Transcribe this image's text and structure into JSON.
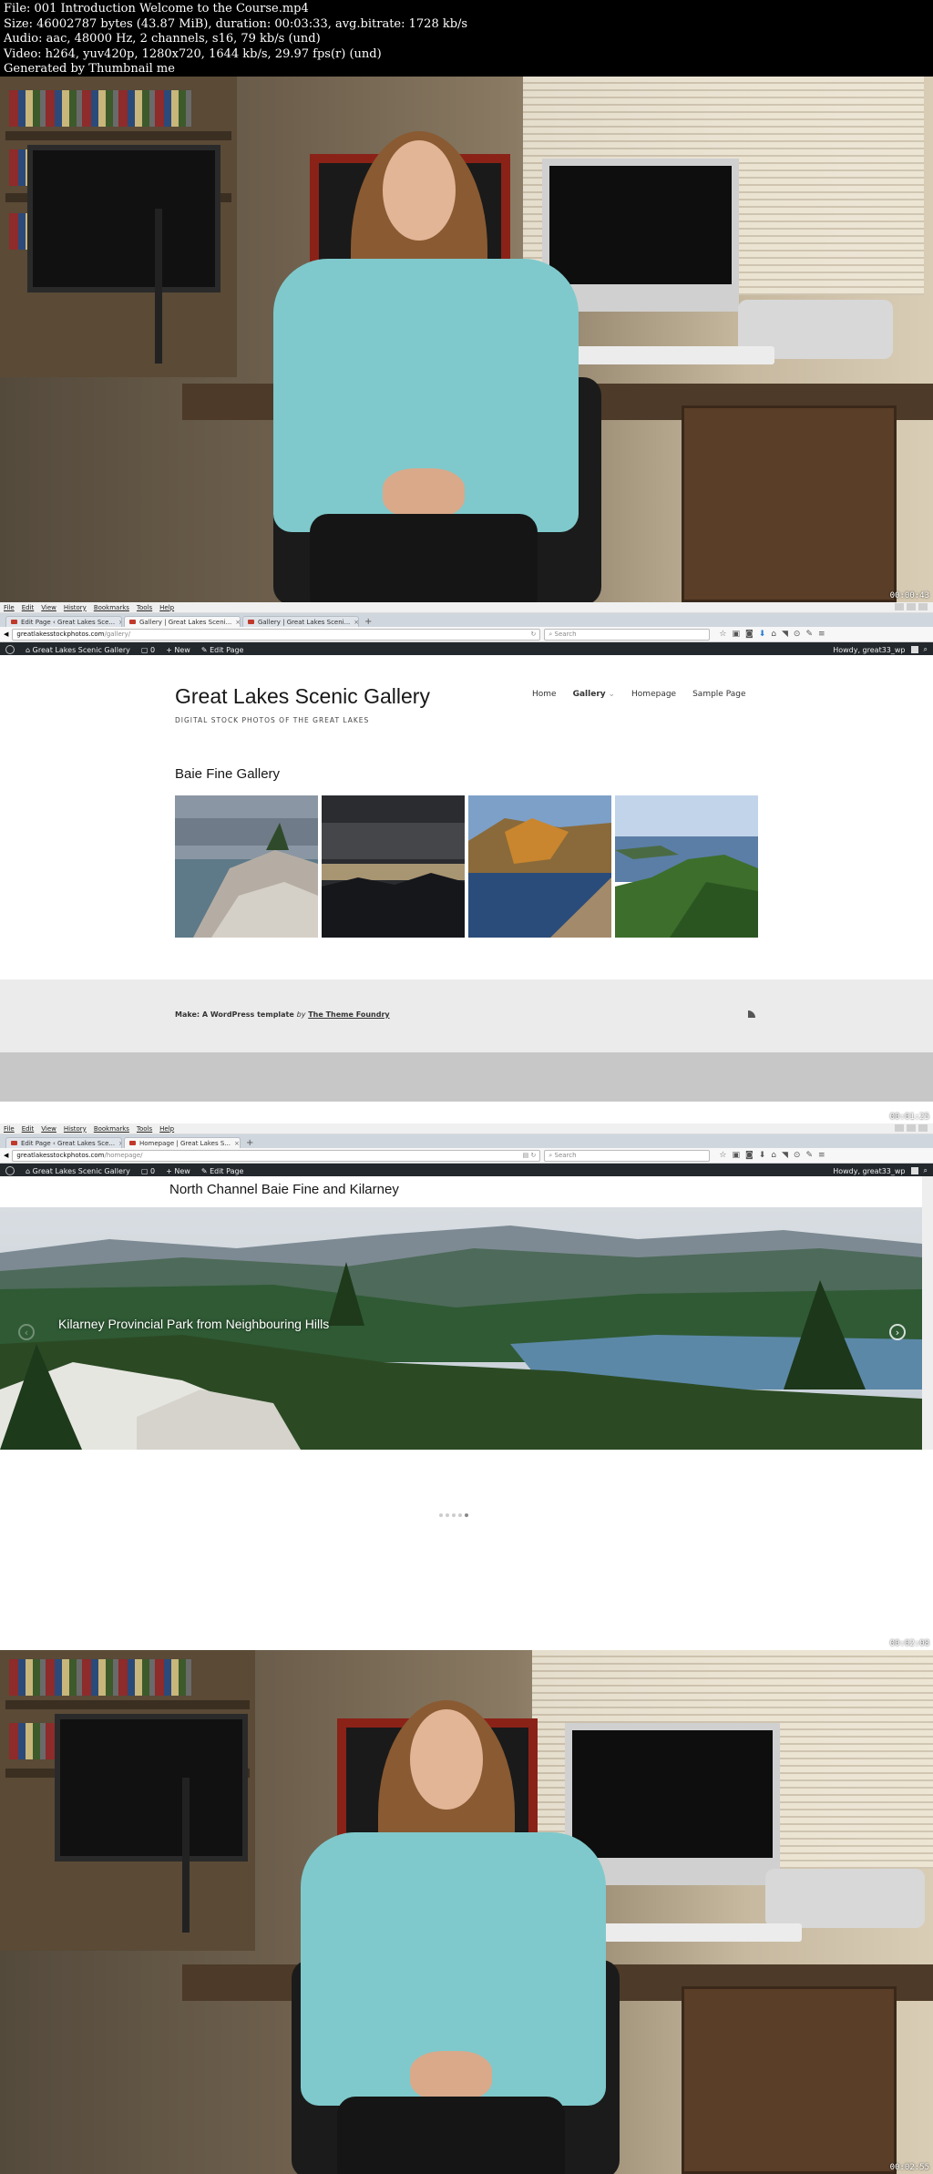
{
  "info": {
    "file": "File: 001 Introduction Welcome to the Course.mp4",
    "size": "Size: 46002787 bytes (43.87 MiB), duration: 00:03:33, avg.bitrate: 1728 kb/s",
    "audio": "Audio: aac, 48000 Hz, 2 channels, s16, 79 kb/s (und)",
    "video": "Video: h264, yuv420p, 1280x720, 1644 kb/s, 29.97 fps(r) (und)",
    "generator": "Generated by Thumbnail me"
  },
  "timestamps": [
    "00:00:43",
    "00:01:25",
    "00:02:08",
    "00:02:55"
  ],
  "browser1": {
    "menu": [
      "File",
      "Edit",
      "View",
      "History",
      "Bookmarks",
      "Tools",
      "Help"
    ],
    "tabs": [
      "Edit Page ‹ Great Lakes Sce...",
      "Gallery | Great Lakes Sceni...",
      "Gallery | Great Lakes Sceni..."
    ],
    "url_domain": "greatlakesstockphotos.com",
    "url_path": "/gallery/",
    "search_placeholder": "Search",
    "admin": {
      "site": "Great Lakes Scenic Gallery",
      "comments": "0",
      "new": "New",
      "edit": "Edit Page",
      "howdy": "Howdy, great33_wp"
    },
    "site_title": "Great Lakes Scenic Gallery",
    "tagline": "DIGITAL STOCK PHOTOS OF THE GREAT LAKES",
    "nav": [
      "Home",
      "Gallery",
      "Homepage",
      "Sample Page"
    ],
    "gallery_title": "Baie Fine Gallery",
    "footer_credit": "Make: A WordPress template",
    "footer_by": "by",
    "footer_link": "The Theme Foundry"
  },
  "browser2": {
    "menu": [
      "File",
      "Edit",
      "View",
      "History",
      "Bookmarks",
      "Tools",
      "Help"
    ],
    "tabs": [
      "Edit Page ‹ Great Lakes Sce...",
      "Homepage | Great Lakes S..."
    ],
    "url_domain": "greatlakesstockphotos.com",
    "url_path": "/homepage/",
    "search_placeholder": "Search",
    "admin": {
      "site": "Great Lakes Scenic Gallery",
      "comments": "0",
      "new": "New",
      "edit": "Edit Page",
      "howdy": "Howdy, great33_wp"
    },
    "page_title": "North Channel Baie Fine and Kilarney",
    "slide_caption": "Kilarney Provincial Park from Neighbouring Hills"
  },
  "colors": {
    "admin_bar": "#23282d",
    "shirt": "#7fc9cc",
    "footer": "#ebebeb"
  }
}
